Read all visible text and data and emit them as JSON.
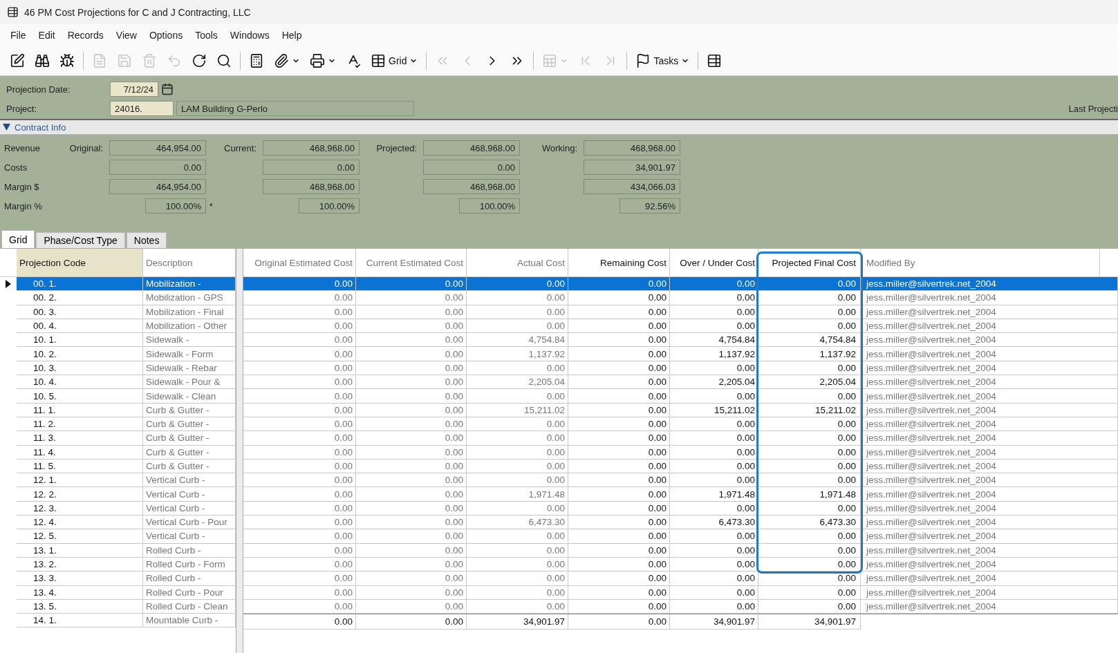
{
  "window": {
    "title": "46 PM Cost Projections for C and J Contracting, LLC"
  },
  "menu": [
    "File",
    "Edit",
    "Records",
    "View",
    "Options",
    "Tools",
    "Windows",
    "Help"
  ],
  "toolbar": [
    {
      "kind": "icon",
      "disabled": false
    },
    {
      "kind": "icon",
      "disabled": false
    },
    {
      "kind": "icon",
      "disabled": false
    },
    {
      "kind": "sep"
    },
    {
      "kind": "icon",
      "disabled": true
    },
    {
      "kind": "icon",
      "disabled": true
    },
    {
      "kind": "icon",
      "disabled": true
    },
    {
      "kind": "icon",
      "disabled": true
    },
    {
      "kind": "icon",
      "disabled": false
    },
    {
      "kind": "icon",
      "disabled": false
    },
    {
      "kind": "sep"
    },
    {
      "kind": "icon",
      "disabled": false
    },
    {
      "kind": "icon",
      "disabled": false,
      "dropdown": true
    },
    {
      "kind": "icon",
      "disabled": false,
      "dropdown": true
    },
    {
      "kind": "icon",
      "disabled": false
    },
    {
      "kind": "icon",
      "label": "Grid",
      "disabled": false,
      "dropdown": true
    },
    {
      "kind": "sep"
    },
    {
      "kind": "icon",
      "disabled": true
    },
    {
      "kind": "icon",
      "disabled": true
    },
    {
      "kind": "icon",
      "disabled": false
    },
    {
      "kind": "icon",
      "disabled": false
    },
    {
      "kind": "sep"
    },
    {
      "kind": "icon",
      "disabled": true,
      "dropdown": true
    },
    {
      "kind": "icon",
      "disabled": true
    },
    {
      "kind": "icon",
      "disabled": true
    },
    {
      "kind": "sep"
    },
    {
      "kind": "icon",
      "label": "Tasks",
      "disabled": false,
      "dropdown": true
    },
    {
      "kind": "sep"
    },
    {
      "kind": "icon",
      "disabled": false
    }
  ],
  "header": {
    "date_label": "Projection Date:",
    "date": "7/12/24",
    "project_label": "Project:",
    "project_code": "24016.",
    "project_name": "LAM Building G-Perlo",
    "right_label": "Last Projecti"
  },
  "contract_info": {
    "title": "Contract Info",
    "expanded": true,
    "column_labels": [
      "Original:",
      "Current:",
      "Projected:",
      "Working:"
    ],
    "rows": [
      {
        "label": "Revenue",
        "values": [
          "464,954.00",
          "468,968.00",
          "468,968.00",
          "468,968.00"
        ]
      },
      {
        "label": "Costs",
        "values": [
          "0.00",
          "0.00",
          "0.00",
          "34,901.97"
        ]
      },
      {
        "label": "Margin $",
        "values": [
          "464,954.00",
          "468,968.00",
          "468,968.00",
          "434,066.03"
        ]
      },
      {
        "label": "Margin %",
        "kind": "percent",
        "values": [
          "100.00%",
          "100.00%",
          "100.00%",
          "92.56%"
        ],
        "note": "*"
      }
    ]
  },
  "tabs": [
    {
      "label": "Grid",
      "selected": true
    },
    {
      "label": "Phase/Cost Type",
      "selected": false
    },
    {
      "label": "Notes",
      "selected": false
    }
  ],
  "grid": {
    "columns": [
      {
        "label": "Projection Code",
        "sorted": true
      },
      {
        "label": "Description"
      },
      {
        "label": "Original Estimated Cost"
      },
      {
        "label": "Current Estimated Cost"
      },
      {
        "label": "Actual Cost"
      },
      {
        "label": "Remaining Cost"
      },
      {
        "label": "Over / Under Cost"
      },
      {
        "label": "Projected Final Cost",
        "highlighted": true
      },
      {
        "label": "Modified By"
      }
    ],
    "rows": [
      {
        "code": "00.  1.",
        "description": "Mobilization -",
        "values": [
          "0.00",
          "0.00",
          "0.00",
          "0.00",
          "0.00",
          "0.00"
        ],
        "modified_by": "jess.miller@silvertrek.net_2004",
        "selected": true
      },
      {
        "code": "00.  2.",
        "description": "Mobilization - GPS",
        "values": [
          "0.00",
          "0.00",
          "0.00",
          "0.00",
          "0.00",
          "0.00"
        ],
        "modified_by": "jess.miller@silvertrek.net_2004",
        "selected": false
      },
      {
        "code": "00.  3.",
        "description": "Mobilization - Final",
        "values": [
          "0.00",
          "0.00",
          "0.00",
          "0.00",
          "0.00",
          "0.00"
        ],
        "modified_by": "jess.miller@silvertrek.net_2004",
        "selected": false
      },
      {
        "code": "00.  4.",
        "description": "Mobilization - Other",
        "values": [
          "0.00",
          "0.00",
          "0.00",
          "0.00",
          "0.00",
          "0.00"
        ],
        "modified_by": "jess.miller@silvertrek.net_2004",
        "selected": false
      },
      {
        "code": "10.  1.",
        "description": "Sidewalk -",
        "values": [
          "0.00",
          "0.00",
          "4,754.84",
          "0.00",
          "4,754.84",
          "4,754.84"
        ],
        "modified_by": "jess.miller@silvertrek.net_2004",
        "selected": false
      },
      {
        "code": "10.  2.",
        "description": "Sidewalk - Form",
        "values": [
          "0.00",
          "0.00",
          "1,137.92",
          "0.00",
          "1,137.92",
          "1,137.92"
        ],
        "modified_by": "jess.miller@silvertrek.net_2004",
        "selected": false
      },
      {
        "code": "10.  3.",
        "description": "Sidewalk - Rebar",
        "values": [
          "0.00",
          "0.00",
          "0.00",
          "0.00",
          "0.00",
          "0.00"
        ],
        "modified_by": "jess.miller@silvertrek.net_2004",
        "selected": false
      },
      {
        "code": "10.  4.",
        "description": "Sidewalk - Pour &",
        "values": [
          "0.00",
          "0.00",
          "2,205.04",
          "0.00",
          "2,205.04",
          "2,205.04"
        ],
        "modified_by": "jess.miller@silvertrek.net_2004",
        "selected": false
      },
      {
        "code": "10.  5.",
        "description": "Sidewalk - Clean",
        "values": [
          "0.00",
          "0.00",
          "0.00",
          "0.00",
          "0.00",
          "0.00"
        ],
        "modified_by": "jess.miller@silvertrek.net_2004",
        "selected": false
      },
      {
        "code": "11.  1.",
        "description": "Curb & Gutter -",
        "values": [
          "0.00",
          "0.00",
          "15,211.02",
          "0.00",
          "15,211.02",
          "15,211.02"
        ],
        "modified_by": "jess.miller@silvertrek.net_2004",
        "selected": false
      },
      {
        "code": "11.  2.",
        "description": "Curb & Gutter -",
        "values": [
          "0.00",
          "0.00",
          "0.00",
          "0.00",
          "0.00",
          "0.00"
        ],
        "modified_by": "jess.miller@silvertrek.net_2004",
        "selected": false
      },
      {
        "code": "11.  3.",
        "description": "Curb & Gutter -",
        "values": [
          "0.00",
          "0.00",
          "0.00",
          "0.00",
          "0.00",
          "0.00"
        ],
        "modified_by": "jess.miller@silvertrek.net_2004",
        "selected": false
      },
      {
        "code": "11.  4.",
        "description": "Curb & Gutter -",
        "values": [
          "0.00",
          "0.00",
          "0.00",
          "0.00",
          "0.00",
          "0.00"
        ],
        "modified_by": "jess.miller@silvertrek.net_2004",
        "selected": false
      },
      {
        "code": "11.  5.",
        "description": "Curb & Gutter -",
        "values": [
          "0.00",
          "0.00",
          "0.00",
          "0.00",
          "0.00",
          "0.00"
        ],
        "modified_by": "jess.miller@silvertrek.net_2004",
        "selected": false
      },
      {
        "code": "12.  1.",
        "description": "Vertical Curb -",
        "values": [
          "0.00",
          "0.00",
          "0.00",
          "0.00",
          "0.00",
          "0.00"
        ],
        "modified_by": "jess.miller@silvertrek.net_2004",
        "selected": false
      },
      {
        "code": "12.  2.",
        "description": "Vertical Curb -",
        "values": [
          "0.00",
          "0.00",
          "1,971.48",
          "0.00",
          "1,971.48",
          "1,971.48"
        ],
        "modified_by": "jess.miller@silvertrek.net_2004",
        "selected": false
      },
      {
        "code": "12.  3.",
        "description": "Vertical Curb -",
        "values": [
          "0.00",
          "0.00",
          "0.00",
          "0.00",
          "0.00",
          "0.00"
        ],
        "modified_by": "jess.miller@silvertrek.net_2004",
        "selected": false
      },
      {
        "code": "12.  4.",
        "description": "Vertical Curb - Pour",
        "values": [
          "0.00",
          "0.00",
          "6,473.30",
          "0.00",
          "6,473.30",
          "6,473.30"
        ],
        "modified_by": "jess.miller@silvertrek.net_2004",
        "selected": false
      },
      {
        "code": "12.  5.",
        "description": "Vertical Curb -",
        "values": [
          "0.00",
          "0.00",
          "0.00",
          "0.00",
          "0.00",
          "0.00"
        ],
        "modified_by": "jess.miller@silvertrek.net_2004",
        "selected": false
      },
      {
        "code": "13.  1.",
        "description": "Rolled Curb -",
        "values": [
          "0.00",
          "0.00",
          "0.00",
          "0.00",
          "0.00",
          "0.00"
        ],
        "modified_by": "jess.miller@silvertrek.net_2004",
        "selected": false
      },
      {
        "code": "13.  2.",
        "description": "Rolled Curb - Form",
        "values": [
          "0.00",
          "0.00",
          "0.00",
          "0.00",
          "0.00",
          "0.00"
        ],
        "modified_by": "jess.miller@silvertrek.net_2004",
        "selected": false
      },
      {
        "code": "13.  3.",
        "description": "Rolled Curb -",
        "values": [
          "0.00",
          "0.00",
          "0.00",
          "0.00",
          "0.00",
          "0.00"
        ],
        "modified_by": "jess.miller@silvertrek.net_2004",
        "selected": false
      },
      {
        "code": "13.  4.",
        "description": "Rolled Curb - Pour",
        "values": [
          "0.00",
          "0.00",
          "0.00",
          "0.00",
          "0.00",
          "0.00"
        ],
        "modified_by": "jess.miller@silvertrek.net_2004",
        "selected": false
      },
      {
        "code": "13.  5.",
        "description": "Rolled Curb - Clean",
        "values": [
          "0.00",
          "0.00",
          "0.00",
          "0.00",
          "0.00",
          "0.00"
        ],
        "modified_by": "jess.miller@silvertrek.net_2004",
        "selected": false
      },
      {
        "code": "14.  1.",
        "description": "Mountable Curb -",
        "selected": false
      }
    ],
    "totals": [
      "0.00",
      "0.00",
      "34,901.97",
      "0.00",
      "34,901.97",
      "34,901.97"
    ]
  }
}
